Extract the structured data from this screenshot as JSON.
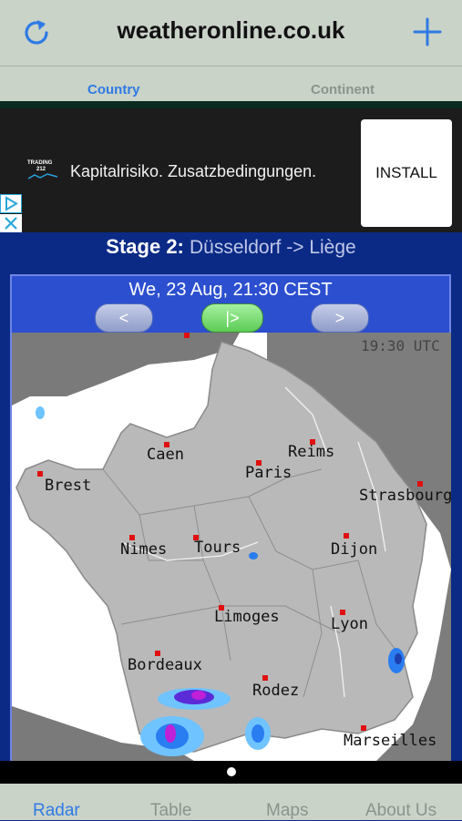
{
  "header": {
    "title": "weatheronline.co.uk",
    "refresh_icon": "refresh-icon",
    "add_icon": "plus-icon"
  },
  "segments": {
    "country": "Country",
    "continent": "Continent",
    "active": "Country"
  },
  "ad": {
    "text": "Kapitalrisiko. Zusatzbedingungen.",
    "button": "INSTALL",
    "logo_line1": "TRADING",
    "logo_line2": "212"
  },
  "stage": {
    "label": "Stage 2:",
    "route": "Düsseldorf -> Liège"
  },
  "radar": {
    "datetime": "We, 23 Aug, 21:30 CEST",
    "prev": "<",
    "play": "|>",
    "next": ">",
    "utc": "19:30 UTC",
    "cities": [
      "Caen",
      "Reims",
      "Paris",
      "Brest",
      "Strasbourg",
      "Nimes",
      "Tours",
      "Dijon",
      "Limoges",
      "Lyon",
      "Bordeaux",
      "Rodez",
      "Marseilles"
    ]
  },
  "tabs": {
    "radar": "Radar",
    "table": "Table",
    "maps": "Maps",
    "about": "About Us",
    "active": "Radar"
  },
  "colors": {
    "accent": "#2f7ae5",
    "bar": "#c9d3c8",
    "panel": "#0b2a86"
  }
}
